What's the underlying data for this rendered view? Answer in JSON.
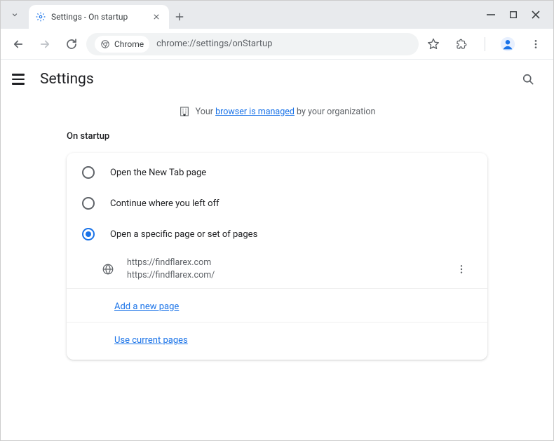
{
  "window": {
    "tab_title": "Settings - On startup"
  },
  "urlbar": {
    "chip": "Chrome",
    "url": "chrome://settings/onStartup"
  },
  "header": {
    "title": "Settings"
  },
  "managed": {
    "prefix": "Your ",
    "link": "browser is managed",
    "suffix": " by your organization"
  },
  "section": {
    "title": "On startup",
    "options": [
      {
        "label": "Open the New Tab page",
        "selected": false
      },
      {
        "label": "Continue where you left off",
        "selected": false
      },
      {
        "label": "Open a specific page or set of pages",
        "selected": true
      }
    ],
    "startup_page": {
      "line1": "https://findflarex.com",
      "line2": "https://findflarex.com/"
    },
    "add_page": "Add a new page",
    "use_current": "Use current pages"
  }
}
